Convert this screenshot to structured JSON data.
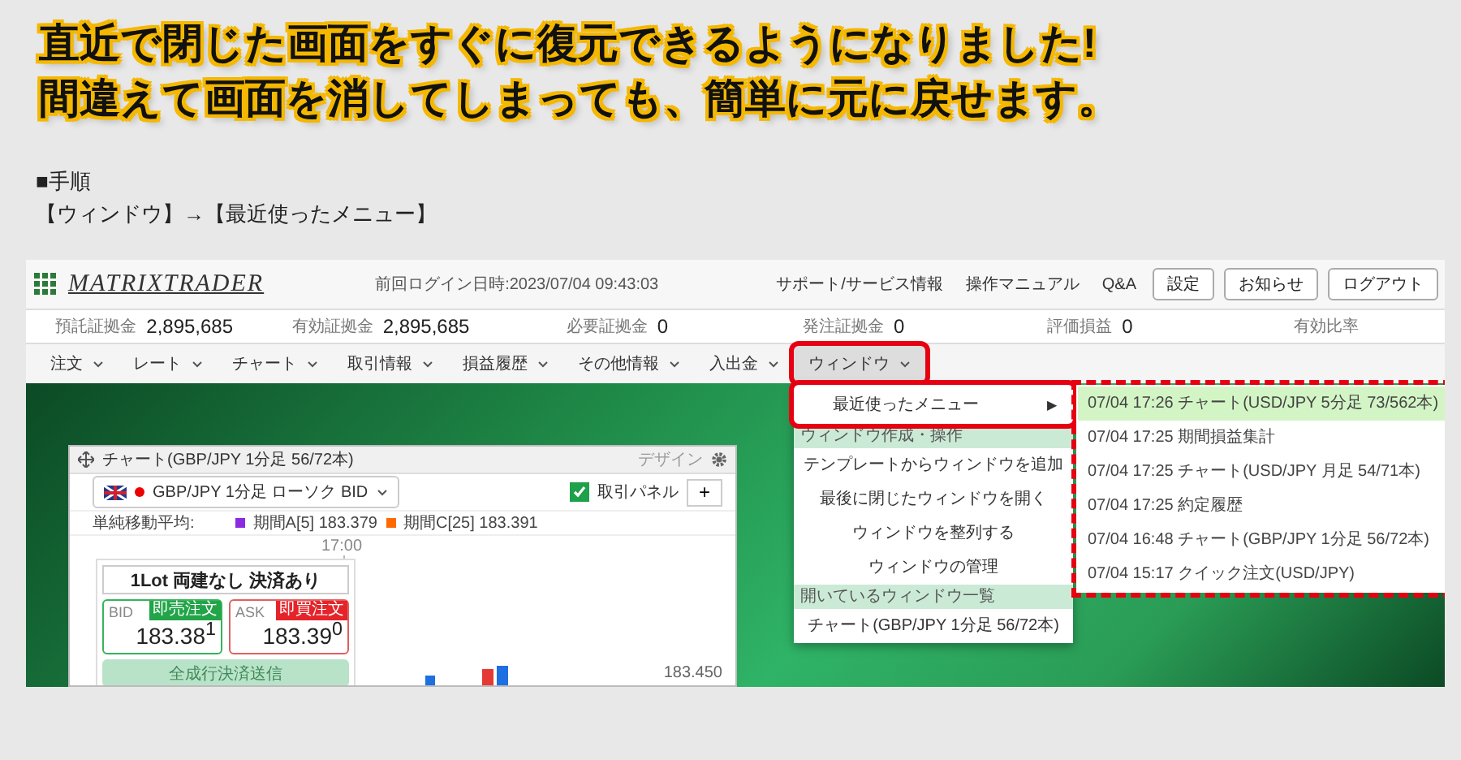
{
  "headline": [
    "直近で閉じた画面をすぐに復元できるようになりました!",
    "間違えて画面を消してしまっても、簡単に元に戻せます。"
  ],
  "steps": {
    "title": "■手順",
    "path": "【ウィンドウ】→【最近使ったメニュー】"
  },
  "app": {
    "logo": "MATRIXTRADER",
    "last_login": "前回ログイン日時:2023/07/04 09:43:03",
    "links": [
      "サポート/サービス情報",
      "操作マニュアル",
      "Q&A"
    ],
    "buttons": [
      "設定",
      "お知らせ",
      "ログアウト"
    ],
    "balances": [
      {
        "label": "預託証拠金",
        "value": "2,895,685"
      },
      {
        "label": "有効証拠金",
        "value": "2,895,685"
      },
      {
        "label": "必要証拠金",
        "value": "0"
      },
      {
        "label": "発注証拠金",
        "value": "0"
      },
      {
        "label": "評価損益",
        "value": "0"
      },
      {
        "label": "有効比率"
      }
    ],
    "nav": [
      {
        "label": "注文",
        "selected": false,
        "highlighted": false
      },
      {
        "label": "レート",
        "selected": false,
        "highlighted": false
      },
      {
        "label": "チャート",
        "selected": false,
        "highlighted": false
      },
      {
        "label": "取引情報",
        "selected": false,
        "highlighted": false
      },
      {
        "label": "損益履歴",
        "selected": false,
        "highlighted": false
      },
      {
        "label": "その他情報",
        "selected": false,
        "highlighted": false
      },
      {
        "label": "入出金",
        "selected": false,
        "highlighted": false
      },
      {
        "label": "ウィンドウ",
        "selected": true,
        "highlighted": true
      }
    ],
    "dropdown": [
      {
        "kind": "submenu",
        "label": "最近使ったメニュー",
        "arrow": "▶",
        "highlighted": true
      },
      {
        "kind": "header",
        "label": "ウィンドウ作成・操作"
      },
      {
        "kind": "item",
        "label": "テンプレートからウィンドウを追加"
      },
      {
        "kind": "item",
        "label": "最後に閉じたウィンドウを開く"
      },
      {
        "kind": "item",
        "label": "ウィンドウを整列する"
      },
      {
        "kind": "item",
        "label": "ウィンドウの管理"
      },
      {
        "kind": "header",
        "label": "開いているウィンドウ一覧"
      },
      {
        "kind": "item",
        "label": "チャート(GBP/JPY 1分足 56/72本)"
      }
    ],
    "recent_menu": {
      "dashed_frame": true,
      "items": [
        {
          "label": "07/04 17:26 チャート(USD/JPY 5分足 73/562本)",
          "selected": true
        },
        {
          "label": "07/04 17:25 期間損益集計",
          "selected": false
        },
        {
          "label": "07/04 17:25 チャート(USD/JPY 月足 54/71本)",
          "selected": false
        },
        {
          "label": "07/04 17:25 約定履歴",
          "selected": false
        },
        {
          "label": "07/04 16:48 チャート(GBP/JPY 1分足 56/72本)",
          "selected": false
        },
        {
          "label": "07/04 15:17 クイック注文(USD/JPY)",
          "selected": false
        }
      ]
    },
    "chart_window": {
      "title": "チャート(GBP/JPY 1分足 56/72本)",
      "design_label": "デザイン",
      "symbol": "GBP/JPY 1分足 ローソク BID",
      "trade_panel_toggle": {
        "label": "取引パネル",
        "checked": true
      },
      "add_button": "+",
      "indicators": {
        "label": "単純移動平均:",
        "items": [
          {
            "label": "期間A[5] 183.379",
            "color": "#8a2be2"
          },
          {
            "label": "期間C[25] 183.391",
            "color": "#ff6a00"
          }
        ]
      },
      "time_label": "17:00",
      "price_label": "183.450",
      "order": {
        "lot": "1Lot 両建なし 決済あり",
        "bid": {
          "label": "BID",
          "tag": "即売注文",
          "price": "183.38$^{1}$"
        },
        "ask": {
          "label": "ASK",
          "tag": "即買注文",
          "price": "183.39$^{0}$"
        },
        "close_all": {
          "label": "全成行決済送信",
          "disabled": true
        }
      }
    }
  }
}
